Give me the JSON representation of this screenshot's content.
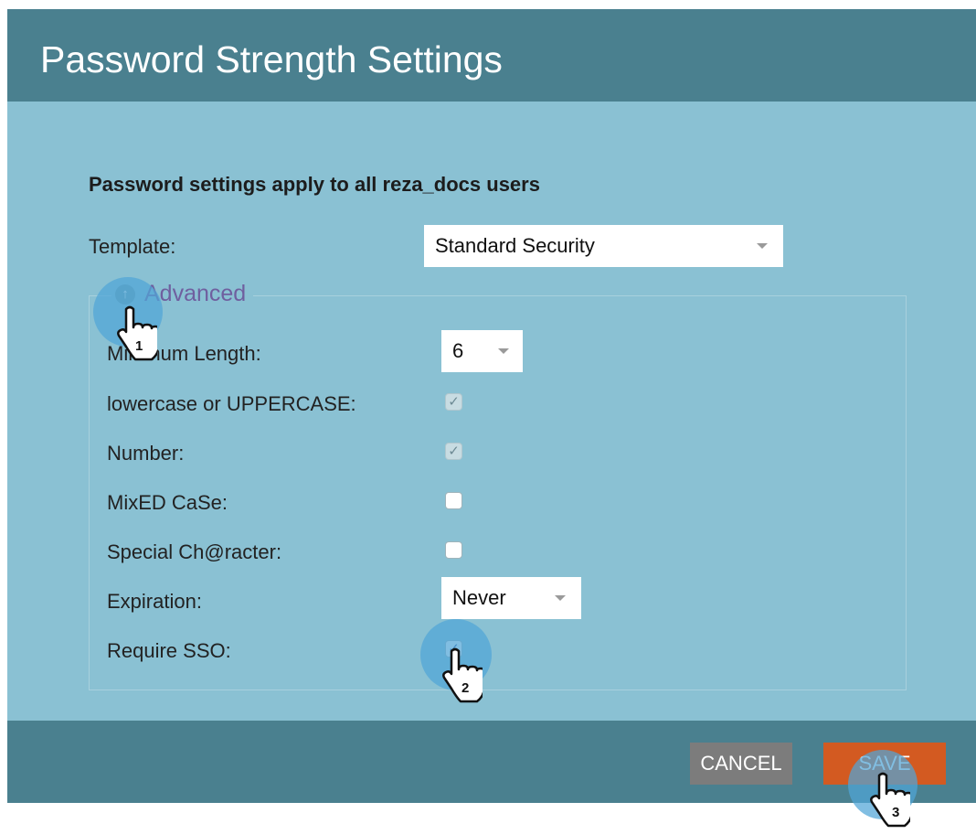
{
  "dialog": {
    "title": "Password Strength Settings",
    "notice": "Password settings apply to all reza_docs users"
  },
  "template": {
    "label": "Template:",
    "value": "Standard Security"
  },
  "advanced": {
    "label": "Advanced",
    "icon": "arrow-up-circle-icon"
  },
  "fields": {
    "min_length": {
      "label": "Minimum Length:",
      "value": "6"
    },
    "case": {
      "label": "lowercase or UPPERCASE:",
      "checked": true,
      "disabled": true
    },
    "number": {
      "label": "Number:",
      "checked": true,
      "disabled": true
    },
    "mixed_case": {
      "label": "MixED CaSe:",
      "checked": false
    },
    "special": {
      "label": "Special Ch@racter:",
      "checked": false
    },
    "expiration": {
      "label": "Expiration:",
      "value": "Never"
    },
    "require_sso": {
      "label": "Require SSO:",
      "checked": true
    }
  },
  "buttons": {
    "cancel": "CANCEL",
    "save": "SAVE"
  },
  "steps": [
    "1",
    "2",
    "3"
  ],
  "colors": {
    "header": "#4a808f",
    "body": "#8ac1d3",
    "save": "#d35a21",
    "cancel": "#7c7c7c",
    "callout": "#50a5d7"
  }
}
